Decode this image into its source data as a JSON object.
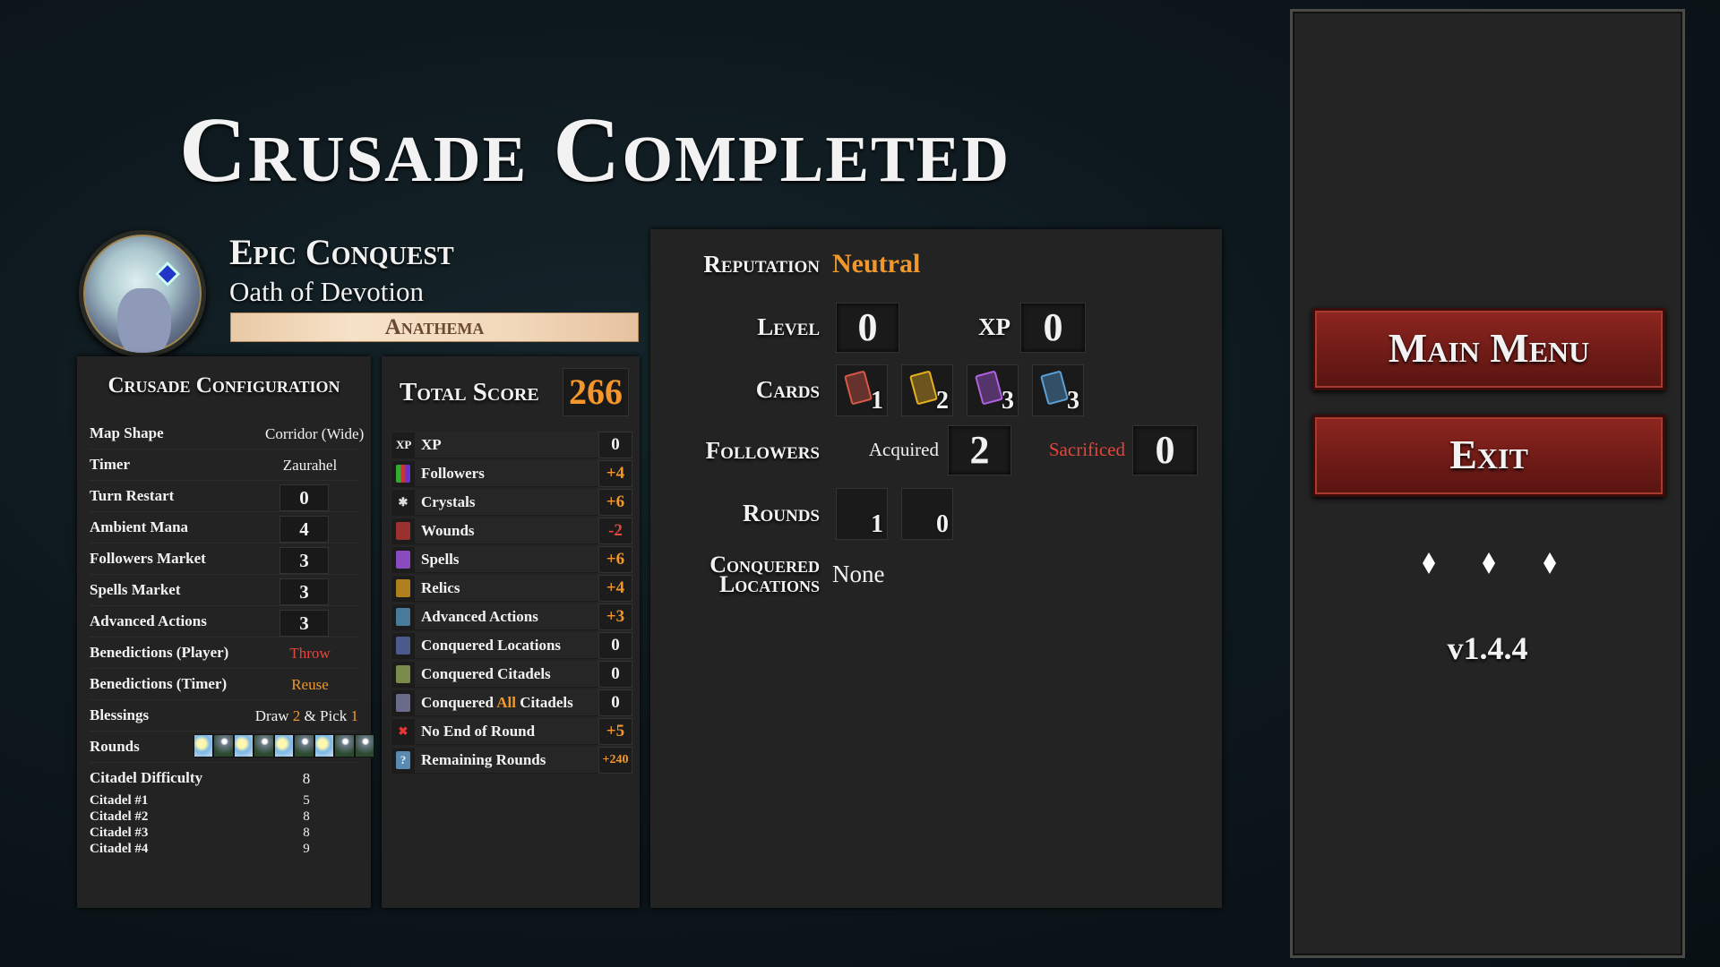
{
  "title": "Crusade Completed",
  "header": {
    "mode": "Epic Conquest",
    "oath": "Oath of Devotion",
    "banner": "Anathema"
  },
  "config": {
    "heading": "Crusade Configuration",
    "rows": [
      {
        "label": "Map Shape",
        "value": "Corridor (Wide)"
      },
      {
        "label": "Timer",
        "value": "Zaurahel"
      },
      {
        "label": "Turn Restart",
        "value": "0"
      },
      {
        "label": "Ambient Mana",
        "value": "4"
      },
      {
        "label": "Followers Market",
        "value": "3"
      },
      {
        "label": "Spells Market",
        "value": "3"
      },
      {
        "label": "Advanced Actions",
        "value": "3"
      },
      {
        "label": "Benedictions (Player)",
        "value": "Throw"
      },
      {
        "label": "Benedictions (Timer)",
        "value": "Reuse"
      },
      {
        "label": "Blessings",
        "draw": "Draw",
        "draw_n": "2",
        "amp": "& Pick",
        "pick_n": "1"
      },
      {
        "label": "Rounds",
        "sequence": [
          "day",
          "night",
          "day",
          "night",
          "day",
          "night",
          "day",
          "night",
          "night"
        ]
      },
      {
        "label": "Citadel Difficulty",
        "value": "8"
      }
    ],
    "citadels": [
      {
        "label": "Citadel #1",
        "value": "5"
      },
      {
        "label": "Citadel #2",
        "value": "8"
      },
      {
        "label": "Citadel #3",
        "value": "8"
      },
      {
        "label": "Citadel #4",
        "value": "9"
      }
    ]
  },
  "score": {
    "label": "Total Score",
    "total": "266",
    "rows": [
      {
        "icon": "xp-icon",
        "glyph": "XP",
        "label": "XP",
        "value": "0"
      },
      {
        "icon": "followers-icon",
        "label": "Followers",
        "value": "+4"
      },
      {
        "icon": "crystals-icon",
        "label": "Crystals",
        "value": "+6"
      },
      {
        "icon": "wounds-icon",
        "label": "Wounds",
        "value": "-2"
      },
      {
        "icon": "spells-icon",
        "label": "Spells",
        "value": "+6"
      },
      {
        "icon": "relics-icon",
        "label": "Relics",
        "value": "+4"
      },
      {
        "icon": "advanced-actions-icon",
        "label": "Advanced Actions",
        "value": "+3"
      },
      {
        "icon": "conquered-locations-icon",
        "label": "Conquered Locations",
        "value": "0"
      },
      {
        "icon": "conquered-citadels-icon",
        "label": "Conquered Citadels",
        "value": "0"
      },
      {
        "icon": "conquered-all-citadels-icon",
        "label_a": "Conquered",
        "label_b": "All",
        "label_c": "Citadels",
        "value": "0"
      },
      {
        "icon": "no-end-of-round-icon",
        "label": "No End of Round",
        "value": "+5"
      },
      {
        "icon": "remaining-rounds-icon",
        "glyph": "?",
        "label": "Remaining Rounds",
        "value": "+240"
      }
    ]
  },
  "summary": {
    "reputation_label": "Reputation",
    "reputation": "Neutral",
    "level_label": "Level",
    "level": "0",
    "xp_label": "XP",
    "xp": "0",
    "cards_label": "Cards",
    "cards": [
      {
        "type": "wound",
        "color": "#d8584a",
        "count": "1"
      },
      {
        "type": "relic",
        "color": "#e6b020",
        "count": "2"
      },
      {
        "type": "spell",
        "color": "#b060e0",
        "count": "3"
      },
      {
        "type": "advanced-action",
        "color": "#5aa0d8",
        "count": "3"
      }
    ],
    "followers_label": "Followers",
    "acquired_label": "Acquired",
    "acquired": "2",
    "sacrificed_label": "Sacrificed",
    "sacrificed": "0",
    "rounds_label": "Rounds",
    "day_rounds": "1",
    "night_rounds": "0",
    "conquered_label_1": "Conquered",
    "conquered_label_2": "Locations",
    "conquered": "None"
  },
  "sidebar": {
    "main_menu": "Main Menu",
    "exit": "Exit",
    "version": "v1.4.4"
  },
  "colors": {
    "accent": "#f0982c",
    "negative": "#e8453a",
    "button": "#7a1e19"
  }
}
